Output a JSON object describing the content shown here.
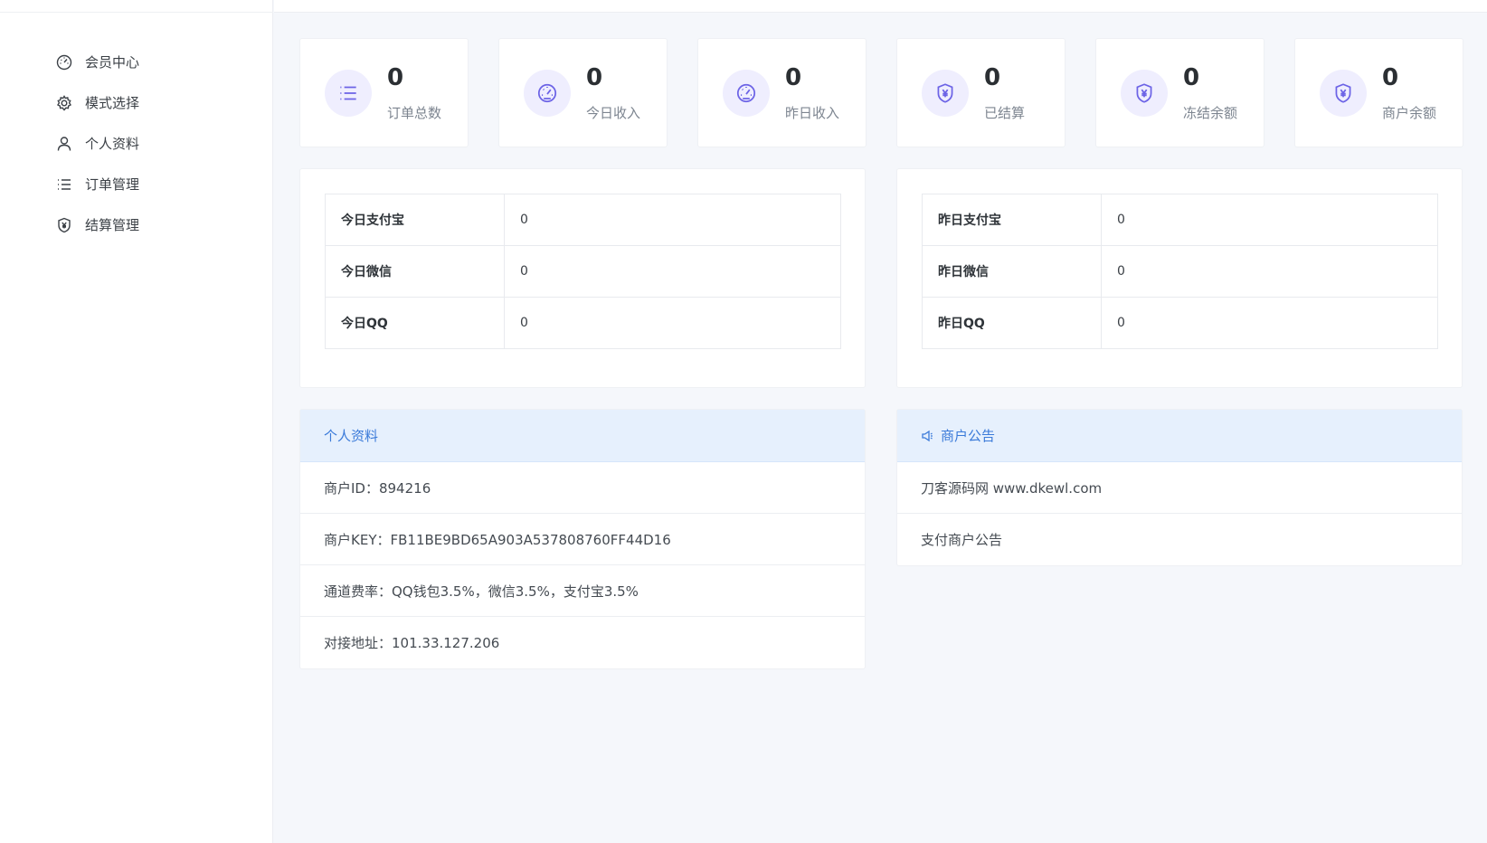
{
  "sidebar": {
    "items": [
      {
        "label": "会员中心",
        "icon": "dashboard-icon"
      },
      {
        "label": "模式选择",
        "icon": "gear-icon"
      },
      {
        "label": "个人资料",
        "icon": "user-icon"
      },
      {
        "label": "订单管理",
        "icon": "list-icon"
      },
      {
        "label": "结算管理",
        "icon": "shield-yen-icon"
      }
    ]
  },
  "stats": [
    {
      "value": "0",
      "label": "订单总数",
      "icon": "list-icon"
    },
    {
      "value": "0",
      "label": "今日收入",
      "icon": "speedometer-icon"
    },
    {
      "value": "0",
      "label": "昨日收入",
      "icon": "speedometer-icon"
    },
    {
      "value": "0",
      "label": "已结算",
      "icon": "shield-yen-icon"
    },
    {
      "value": "0",
      "label": "冻结余额",
      "icon": "shield-yen-icon"
    },
    {
      "value": "0",
      "label": "商户余额",
      "icon": "shield-yen-icon"
    }
  ],
  "today_table": {
    "rows": [
      {
        "key": "今日支付宝",
        "value": "0"
      },
      {
        "key": "今日微信",
        "value": "0"
      },
      {
        "key": "今日QQ",
        "value": "0"
      }
    ]
  },
  "yesterday_table": {
    "rows": [
      {
        "key": "昨日支付宝",
        "value": "0"
      },
      {
        "key": "昨日微信",
        "value": "0"
      },
      {
        "key": "昨日QQ",
        "value": "0"
      }
    ]
  },
  "profile": {
    "title": "个人资料",
    "rows": [
      "商户ID：894216",
      "商户KEY：FB11BE9BD65A903A537808760FF44D16",
      "通道费率：QQ钱包3.5%，微信3.5%，支付宝3.5%",
      "对接地址：101.33.127.206"
    ]
  },
  "notice": {
    "title": "商户公告",
    "icon": "megaphone-icon",
    "rows": [
      "刀客源码网 www.dkewl.com",
      "支付商户公告"
    ]
  },
  "colors": {
    "accent": "#6c63e6",
    "icon_bg": "#efeefe",
    "panel_head_bg": "#e6f0fd",
    "panel_head_text": "#3a7ad9"
  }
}
